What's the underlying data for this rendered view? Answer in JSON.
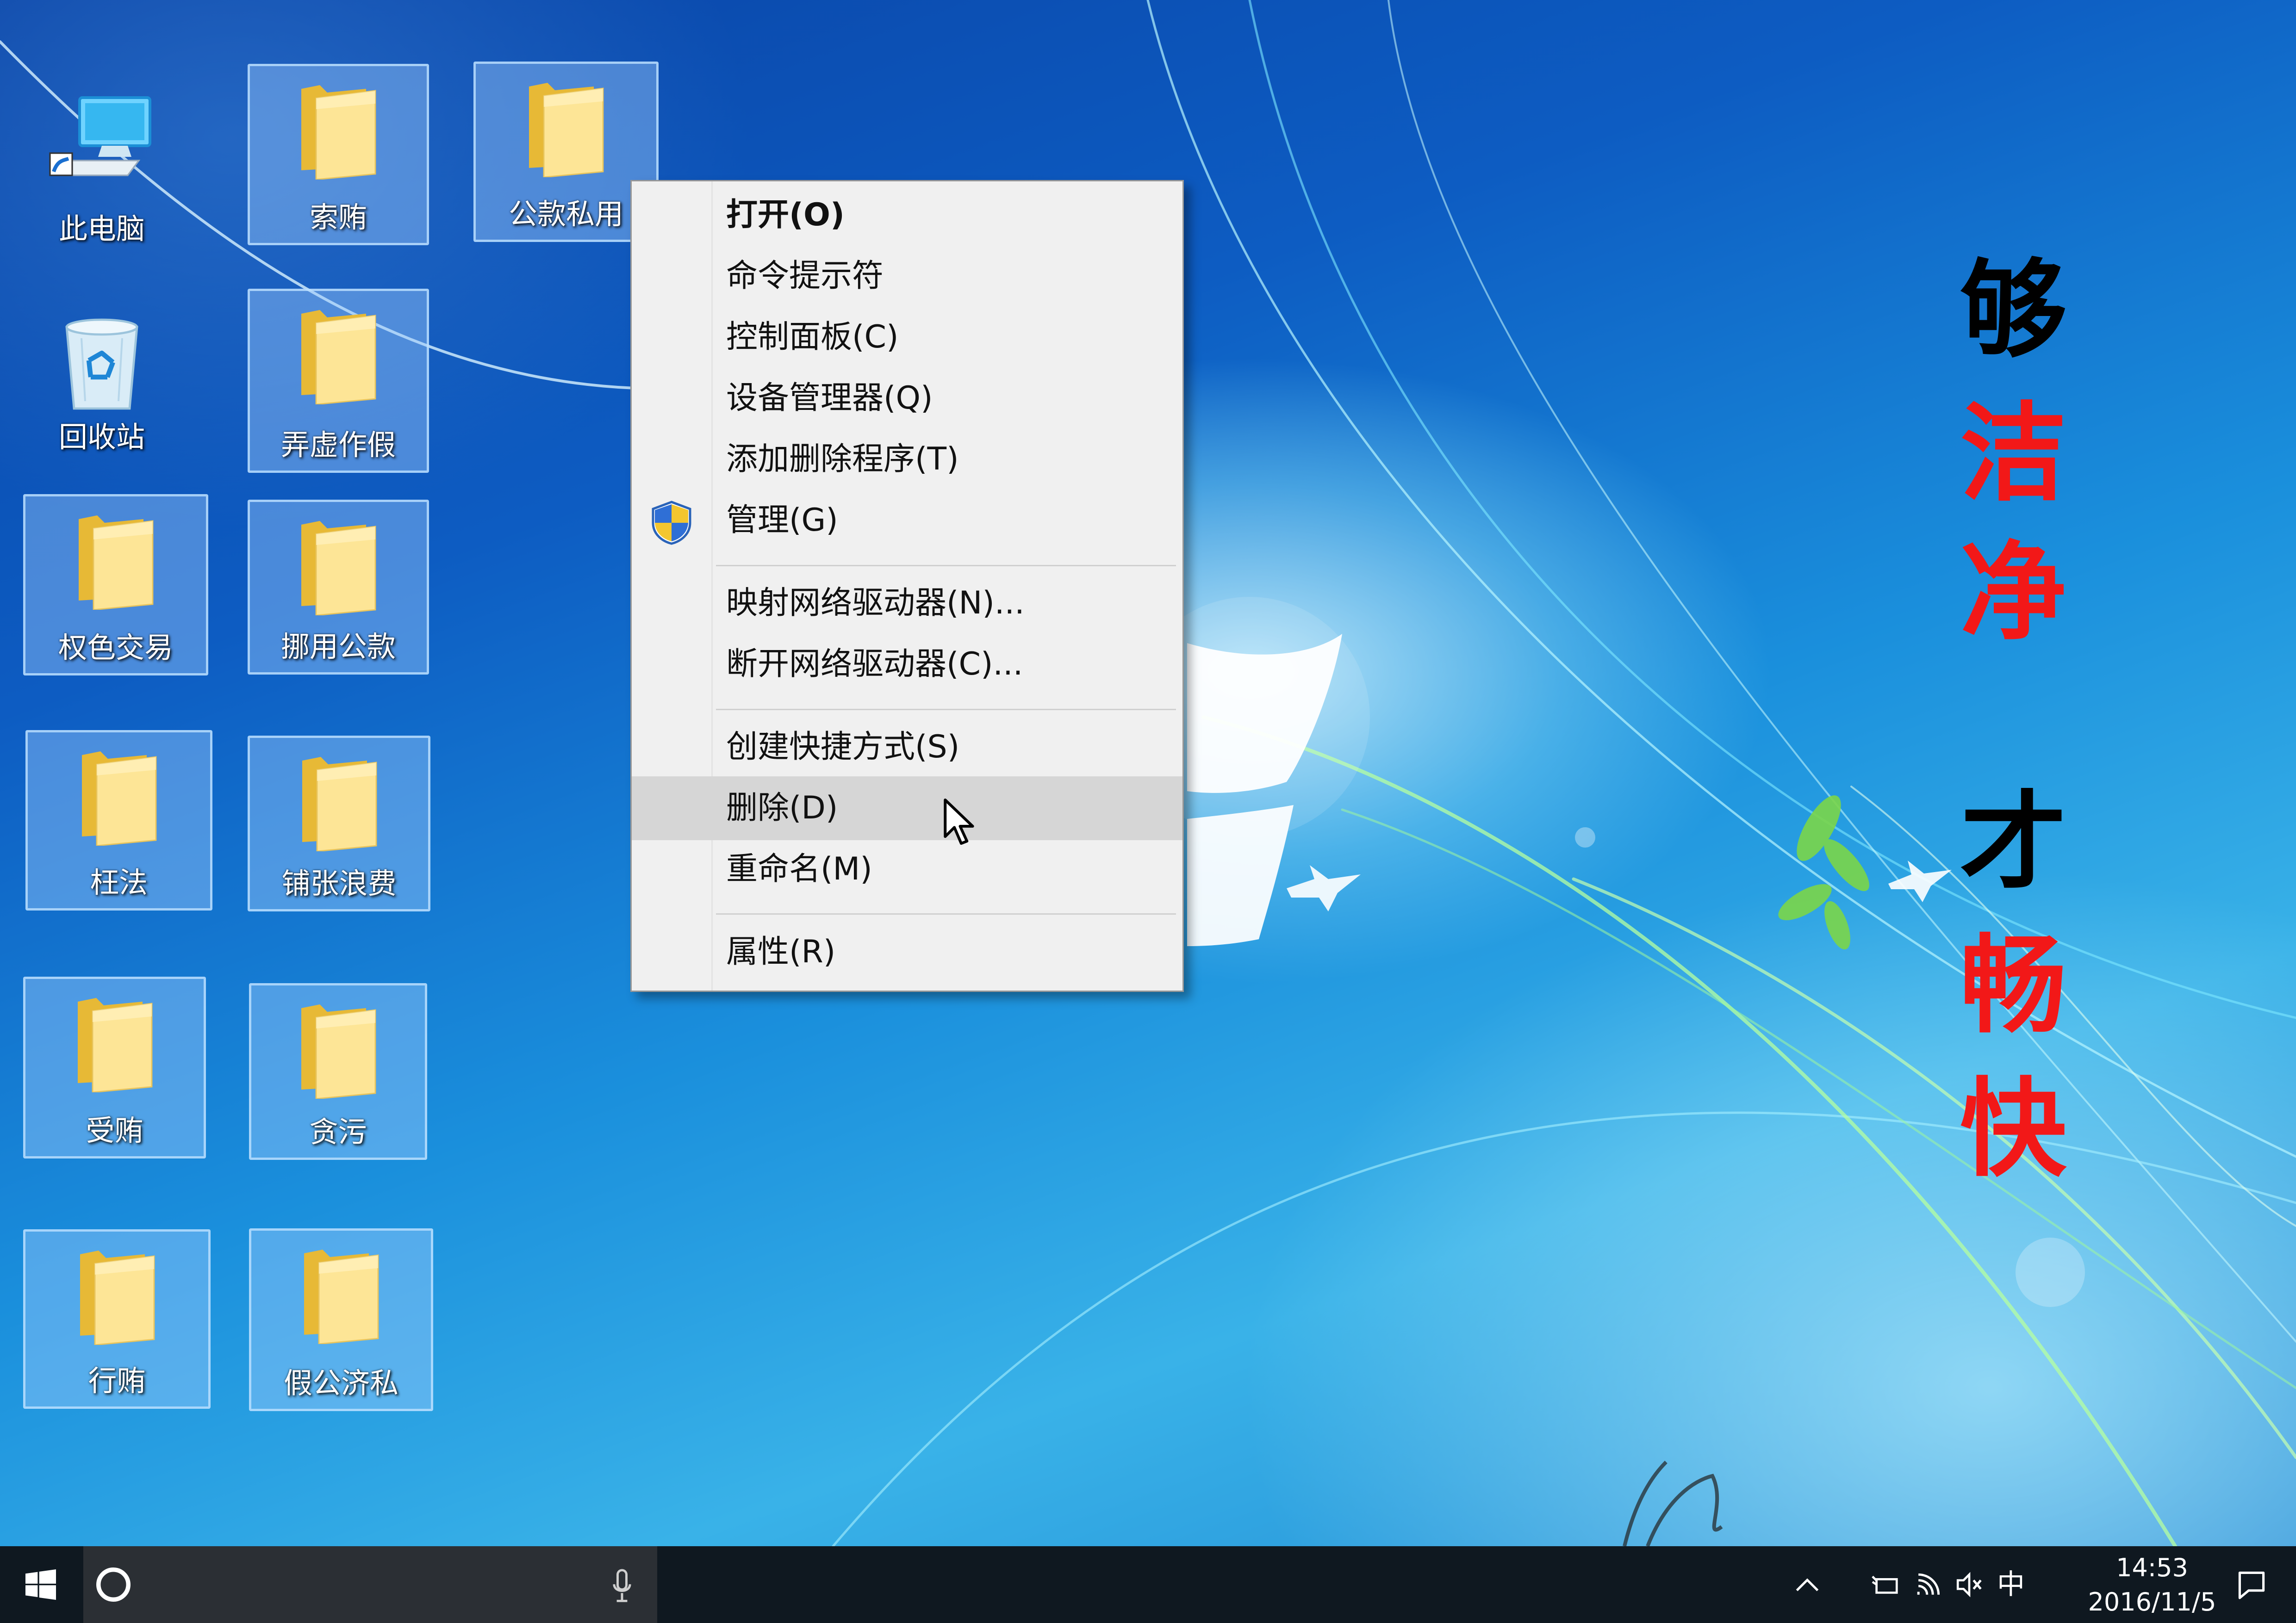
{
  "desktop_icons": [
    {
      "label": "此电脑",
      "type": "computer",
      "selected": false
    },
    {
      "label": "回收站",
      "type": "recycle-bin",
      "selected": false
    },
    {
      "label": "权色交易",
      "type": "folder",
      "selected": true
    },
    {
      "label": "枉法",
      "type": "folder",
      "selected": true
    },
    {
      "label": "受贿",
      "type": "folder",
      "selected": true
    },
    {
      "label": "行贿",
      "type": "folder",
      "selected": true
    },
    {
      "label": "索贿",
      "type": "folder",
      "selected": true
    },
    {
      "label": "弄虚作假",
      "type": "folder",
      "selected": true
    },
    {
      "label": "挪用公款",
      "type": "folder",
      "selected": true
    },
    {
      "label": "铺张浪费",
      "type": "folder",
      "selected": true
    },
    {
      "label": "贪污",
      "type": "folder",
      "selected": true
    },
    {
      "label": "假公济私",
      "type": "folder",
      "selected": true
    },
    {
      "label": "公款私用",
      "type": "folder",
      "selected": true
    }
  ],
  "context_menu": {
    "items": [
      {
        "label": "打开(O)",
        "bold": true
      },
      {
        "label": "命令提示符"
      },
      {
        "label": "控制面板(C)"
      },
      {
        "label": "设备管理器(Q)"
      },
      {
        "label": "添加删除程序(T)"
      },
      {
        "label": "管理(G)",
        "icon": "uac-shield-icon"
      },
      {
        "label": "映射网络驱动器(N)..."
      },
      {
        "label": "断开网络驱动器(C)..."
      },
      {
        "label": "创建快捷方式(S)"
      },
      {
        "label": "删除(D)",
        "highlighted": true
      },
      {
        "label": "重命名(M)"
      },
      {
        "label": "属性(R)"
      }
    ]
  },
  "slogan": {
    "left_column": [
      {
        "char": "够",
        "color": "#000000"
      },
      {
        "char": "洁",
        "color": "#f21818"
      },
      {
        "char": "净",
        "color": "#f21818"
      }
    ],
    "right_column": [
      {
        "char": "才",
        "color": "#000000"
      },
      {
        "char": "畅",
        "color": "#f21818"
      },
      {
        "char": "快",
        "color": "#f21818"
      }
    ]
  },
  "taskbar": {
    "start_icon": "windows-logo-icon",
    "search_icon": "cortana-circle-icon",
    "mic_icon": "microphone-icon",
    "tray_icons": [
      "chevron-up-icon",
      "power-plug-icon",
      "wifi-icon",
      "volume-muted-icon"
    ],
    "ime_indicator": "中",
    "clock_time": "14:53",
    "clock_date": "2016/11/5",
    "notification_icon": "action-center-icon"
  }
}
